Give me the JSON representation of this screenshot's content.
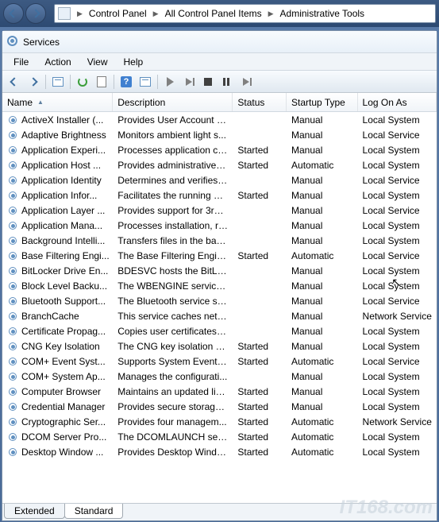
{
  "breadcrumb": {
    "items": [
      "Control Panel",
      "All Control Panel Items",
      "Administrative Tools"
    ]
  },
  "window": {
    "title": "Services"
  },
  "menu": {
    "file": "File",
    "action": "Action",
    "view": "View",
    "help": "Help"
  },
  "columns": {
    "name": "Name",
    "description": "Description",
    "status": "Status",
    "startup": "Startup Type",
    "logon": "Log On As"
  },
  "tabs": {
    "extended": "Extended",
    "standard": "Standard"
  },
  "help_glyph": "?",
  "services": [
    {
      "name": "ActiveX Installer (...",
      "desc": "Provides User Account C...",
      "status": "",
      "startup": "Manual",
      "logon": "Local System"
    },
    {
      "name": "Adaptive Brightness",
      "desc": "Monitors ambient light s...",
      "status": "",
      "startup": "Manual",
      "logon": "Local Service"
    },
    {
      "name": "Application Experi...",
      "desc": "Processes application co...",
      "status": "Started",
      "startup": "Manual",
      "logon": "Local System"
    },
    {
      "name": "Application Host ...",
      "desc": "Provides administrative s...",
      "status": "Started",
      "startup": "Automatic",
      "logon": "Local System"
    },
    {
      "name": "Application Identity",
      "desc": "Determines and verifies t...",
      "status": "",
      "startup": "Manual",
      "logon": "Local Service"
    },
    {
      "name": "Application Infor...",
      "desc": "Facilitates the running of...",
      "status": "Started",
      "startup": "Manual",
      "logon": "Local System"
    },
    {
      "name": "Application Layer ...",
      "desc": "Provides support for 3rd ...",
      "status": "",
      "startup": "Manual",
      "logon": "Local Service"
    },
    {
      "name": "Application Mana...",
      "desc": "Processes installation, re...",
      "status": "",
      "startup": "Manual",
      "logon": "Local System"
    },
    {
      "name": "Background Intelli...",
      "desc": "Transfers files in the bac...",
      "status": "",
      "startup": "Manual",
      "logon": "Local System"
    },
    {
      "name": "Base Filtering Engi...",
      "desc": "The Base Filtering Engine...",
      "status": "Started",
      "startup": "Automatic",
      "logon": "Local Service"
    },
    {
      "name": "BitLocker Drive En...",
      "desc": "BDESVC hosts the BitLoc...",
      "status": "",
      "startup": "Manual",
      "logon": "Local System"
    },
    {
      "name": "Block Level Backu...",
      "desc": "The WBENGINE service is...",
      "status": "",
      "startup": "Manual",
      "logon": "Local System"
    },
    {
      "name": "Bluetooth Support...",
      "desc": "The Bluetooth service su...",
      "status": "",
      "startup": "Manual",
      "logon": "Local Service"
    },
    {
      "name": "BranchCache",
      "desc": "This service caches netw...",
      "status": "",
      "startup": "Manual",
      "logon": "Network Service"
    },
    {
      "name": "Certificate Propag...",
      "desc": "Copies user certificates a...",
      "status": "",
      "startup": "Manual",
      "logon": "Local System"
    },
    {
      "name": "CNG Key Isolation",
      "desc": "The CNG key isolation se...",
      "status": "Started",
      "startup": "Manual",
      "logon": "Local System"
    },
    {
      "name": "COM+ Event Syst...",
      "desc": "Supports System Event N...",
      "status": "Started",
      "startup": "Automatic",
      "logon": "Local Service"
    },
    {
      "name": "COM+ System Ap...",
      "desc": "Manages the configurati...",
      "status": "",
      "startup": "Manual",
      "logon": "Local System"
    },
    {
      "name": "Computer Browser",
      "desc": "Maintains an updated lis...",
      "status": "Started",
      "startup": "Manual",
      "logon": "Local System"
    },
    {
      "name": "Credential Manager",
      "desc": "Provides secure storage ...",
      "status": "Started",
      "startup": "Manual",
      "logon": "Local System"
    },
    {
      "name": "Cryptographic Ser...",
      "desc": "Provides four managem...",
      "status": "Started",
      "startup": "Automatic",
      "logon": "Network Service"
    },
    {
      "name": "DCOM Server Pro...",
      "desc": "The DCOMLAUNCH serv...",
      "status": "Started",
      "startup": "Automatic",
      "logon": "Local System"
    },
    {
      "name": "Desktop Window ...",
      "desc": "Provides Desktop Windo...",
      "status": "Started",
      "startup": "Automatic",
      "logon": "Local System"
    }
  ],
  "watermark": "IT168.com"
}
